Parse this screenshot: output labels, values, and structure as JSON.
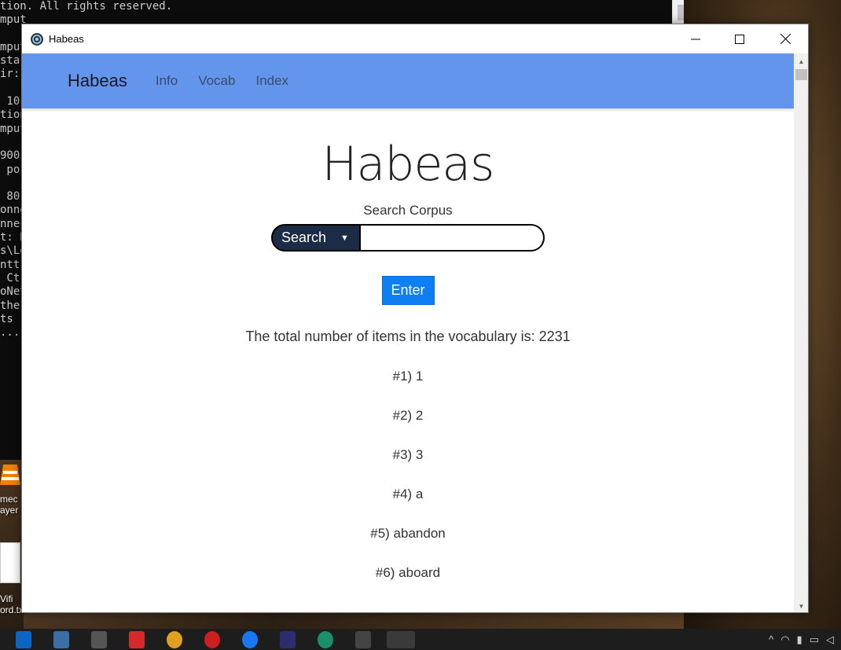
{
  "terminal": {
    "lines": [
      "tion. All rights reserved.",
      "mput",
      "",
      "mput",
      "star",
      "ir:",
      "",
      " 10",
      "tion",
      "mput",
      "",
      "900",
      " por",
      "",
      " 80",
      "onne",
      "nnec",
      "t: R",
      "s\\Lo",
      "ntt",
      " Ctr",
      "oNet",
      "the",
      "ts :",
      "..."
    ]
  },
  "desktop": {
    "icon_labels": [
      "mec\nayer",
      "Vifi\nord.txt"
    ]
  },
  "window": {
    "title": "Habeas",
    "controls": {
      "minimize": "—",
      "maximize": "☐",
      "close": "✕"
    }
  },
  "navbar": {
    "brand": "Habeas",
    "links": [
      "Info",
      "Vocab",
      "Index"
    ]
  },
  "main": {
    "title": "Habeas",
    "search_label": "Search Corpus",
    "search_select_value": "Search",
    "search_input_value": "",
    "enter_label": "Enter",
    "vocab_total_text": "The total number of items in the vocabulary is: 2231",
    "vocab_items": [
      "#1) 1",
      "#2) 2",
      "#3) 3",
      "#4) a",
      "#5) abandon",
      "#6) aboard"
    ]
  },
  "colors": {
    "navbar_bg": "#6495ed",
    "select_bg": "#1c2b46",
    "enter_bg": "#0d7ff2",
    "taskbar_bg": "#1d1d1d"
  },
  "icons": [
    "habeas-app-icon",
    "vlc-icon",
    "text-file-icon",
    "chevron-up-icon",
    "chevron-down-icon"
  ]
}
